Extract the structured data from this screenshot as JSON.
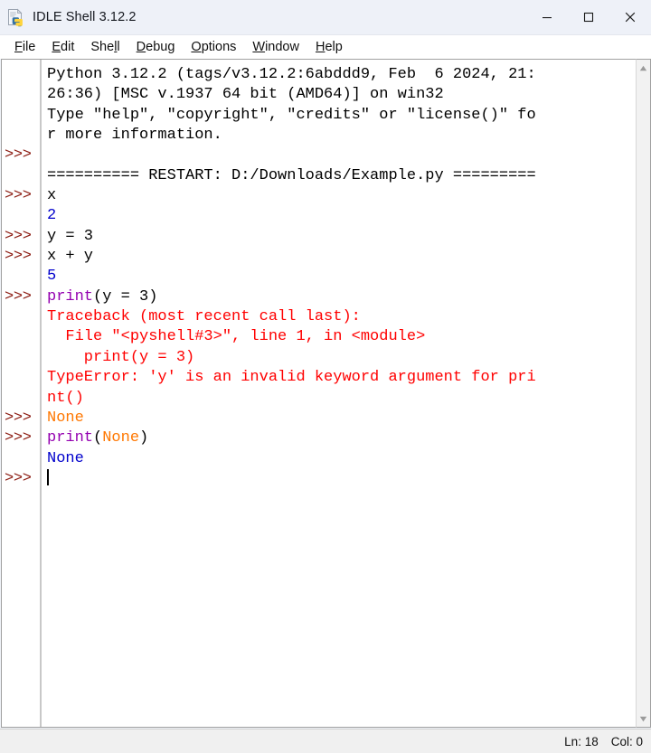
{
  "window": {
    "title": "IDLE Shell 3.12.2",
    "icon": "python-document-icon",
    "controls": {
      "minimize": "minimize-icon",
      "maximize": "maximize-icon",
      "close": "close-icon"
    }
  },
  "menubar": {
    "items": [
      {
        "label": "File",
        "pre": "",
        "accel": "F",
        "post": "ile"
      },
      {
        "label": "Edit",
        "pre": "",
        "accel": "E",
        "post": "dit"
      },
      {
        "label": "Shell",
        "pre": "She",
        "accel": "l",
        "post": "l"
      },
      {
        "label": "Debug",
        "pre": "",
        "accel": "D",
        "post": "ebug"
      },
      {
        "label": "Options",
        "pre": "",
        "accel": "O",
        "post": "ptions"
      },
      {
        "label": "Window",
        "pre": "",
        "accel": "W",
        "post": "indow"
      },
      {
        "label": "Help",
        "pre": "",
        "accel": "H",
        "post": "elp"
      }
    ]
  },
  "shell": {
    "prompt": ">>>",
    "prompt_color": "#8b1a10",
    "output_color": "#0000cc",
    "error_color": "#ff0000",
    "keyword_color": "#ff7700",
    "builtin_color": "#9400b0",
    "lines": [
      {
        "prompt": false,
        "segments": [
          {
            "text": "Python 3.12.2 (tags/v3.12.2:6abddd9, Feb  6 2024, 21:",
            "style": "plain"
          }
        ]
      },
      {
        "prompt": false,
        "segments": [
          {
            "text": "26:36) [MSC v.1937 64 bit (AMD64)] on win32",
            "style": "plain"
          }
        ]
      },
      {
        "prompt": false,
        "segments": [
          {
            "text": "Type \"help\", \"copyright\", \"credits\" or \"license()\" fo",
            "style": "plain"
          }
        ]
      },
      {
        "prompt": false,
        "segments": [
          {
            "text": "r more information.",
            "style": "plain"
          }
        ]
      },
      {
        "prompt": true,
        "segments": [
          {
            "text": "",
            "style": "plain"
          }
        ]
      },
      {
        "prompt": false,
        "segments": [
          {
            "text": "========== RESTART: D:/Downloads/Example.py =========",
            "style": "plain"
          }
        ]
      },
      {
        "prompt": true,
        "segments": [
          {
            "text": "x",
            "style": "plain"
          }
        ]
      },
      {
        "prompt": false,
        "segments": [
          {
            "text": "2",
            "style": "output"
          }
        ]
      },
      {
        "prompt": true,
        "segments": [
          {
            "text": "y = 3",
            "style": "plain"
          }
        ]
      },
      {
        "prompt": true,
        "segments": [
          {
            "text": "x + y",
            "style": "plain"
          }
        ]
      },
      {
        "prompt": false,
        "segments": [
          {
            "text": "5",
            "style": "output"
          }
        ]
      },
      {
        "prompt": true,
        "segments": [
          {
            "text": "print",
            "style": "builtin"
          },
          {
            "text": "(y = 3)",
            "style": "plain"
          }
        ]
      },
      {
        "prompt": false,
        "segments": [
          {
            "text": "Traceback (most recent call last):",
            "style": "error"
          }
        ]
      },
      {
        "prompt": false,
        "segments": [
          {
            "text": "  File \"<pyshell#3>\", line 1, in <module>",
            "style": "error"
          }
        ]
      },
      {
        "prompt": false,
        "segments": [
          {
            "text": "    print(y = 3)",
            "style": "error"
          }
        ]
      },
      {
        "prompt": false,
        "segments": [
          {
            "text": "TypeError: 'y' is an invalid keyword argument for pri",
            "style": "error"
          }
        ]
      },
      {
        "prompt": false,
        "segments": [
          {
            "text": "nt()",
            "style": "error"
          }
        ]
      },
      {
        "prompt": true,
        "segments": [
          {
            "text": "None",
            "style": "keyword"
          }
        ]
      },
      {
        "prompt": true,
        "segments": [
          {
            "text": "print",
            "style": "builtin"
          },
          {
            "text": "(",
            "style": "plain"
          },
          {
            "text": "None",
            "style": "keyword"
          },
          {
            "text": ")",
            "style": "plain"
          }
        ]
      },
      {
        "prompt": false,
        "segments": [
          {
            "text": "None",
            "style": "output"
          }
        ]
      },
      {
        "prompt": true,
        "segments": [
          {
            "text": "",
            "style": "caret"
          }
        ]
      }
    ]
  },
  "scrollbar": {
    "up_arrow": "scroll-up-arrow-icon",
    "down_arrow": "scroll-down-arrow-icon"
  },
  "statusbar": {
    "line_label": "Ln: 18",
    "col_label": "Col: 0"
  }
}
